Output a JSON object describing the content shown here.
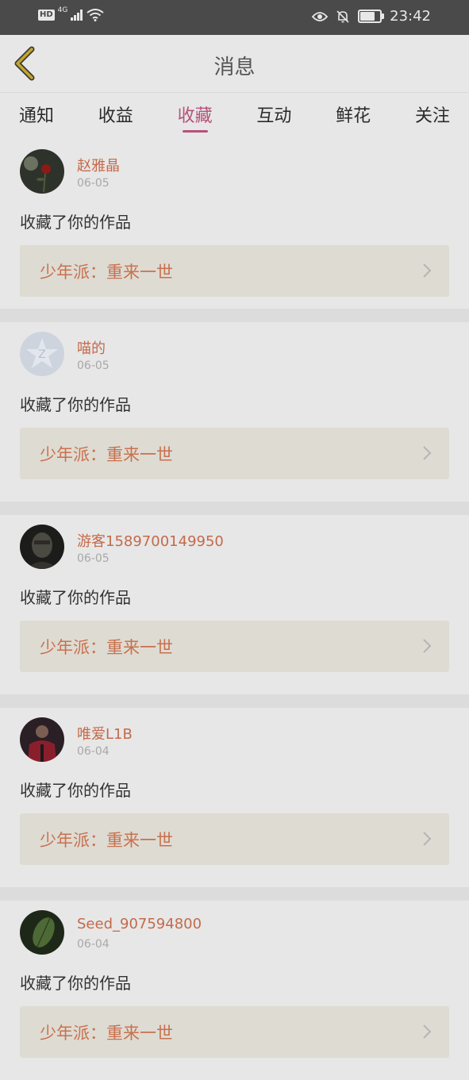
{
  "status": {
    "network": "4G",
    "time": "23:42",
    "battery_level": 0.7
  },
  "header": {
    "title": "消息"
  },
  "tabs": [
    {
      "label": "通知",
      "active": false
    },
    {
      "label": "收益",
      "active": false
    },
    {
      "label": "收藏",
      "active": true
    },
    {
      "label": "互动",
      "active": false
    },
    {
      "label": "鲜花",
      "active": false
    },
    {
      "label": "关注",
      "active": false
    }
  ],
  "messages": [
    {
      "username": "赵雅晶",
      "date": "06-05",
      "action": "收藏了你的作品",
      "work": "少年派：重来一世",
      "avatar": "rose-photo"
    },
    {
      "username": "喵的",
      "date": "06-05",
      "action": "收藏了你的作品",
      "work": "少年派：重来一世",
      "avatar": "default-star-logo"
    },
    {
      "username": "游客1589700149950",
      "date": "06-05",
      "action": "收藏了你的作品",
      "work": "少年派：重来一世",
      "avatar": "dark-portrait"
    },
    {
      "username": "唯爱L1B",
      "date": "06-04",
      "action": "收藏了你的作品",
      "work": "少年派：重来一世",
      "avatar": "person-red-jacket"
    },
    {
      "username": "Seed_907594800",
      "date": "06-04",
      "action": "收藏了你的作品",
      "work": "少年派：重来一世",
      "avatar": "green-leaf"
    }
  ],
  "colors": {
    "accent": "#b6527a",
    "username": "#c46a4a",
    "work_title": "#c8714d",
    "back_arrow": "#c8a52a"
  }
}
